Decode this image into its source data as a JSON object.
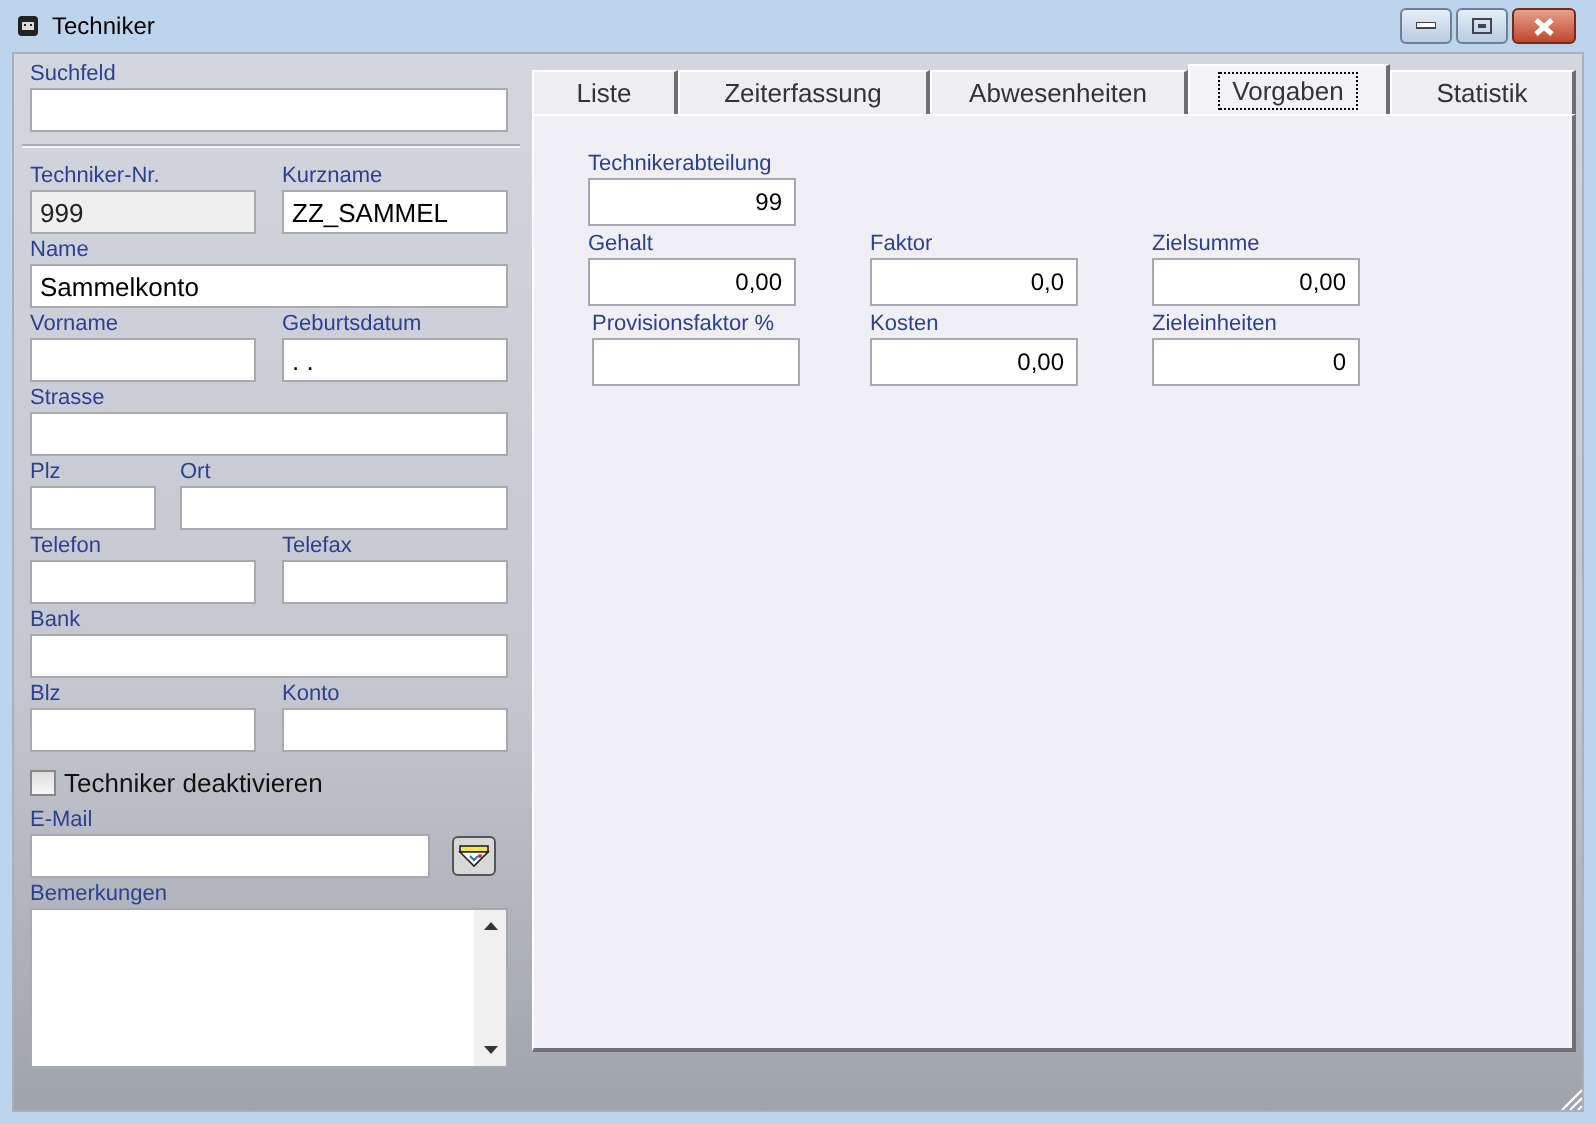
{
  "window": {
    "title": "Techniker"
  },
  "search": {
    "label": "Suchfeld"
  },
  "left_rows": [
    {
      "kind": "split",
      "fields": [
        {
          "label": "Techniker-Nr.",
          "value": "999",
          "disabled": true
        },
        {
          "label": "Kurzname",
          "value": "ZZ_SAMMEL",
          "disabled": false
        }
      ]
    },
    {
      "kind": "full",
      "fields": [
        {
          "label": "Name",
          "value": "Sammelkonto",
          "disabled": false
        }
      ]
    },
    {
      "kind": "split",
      "fields": [
        {
          "label": "Vorname",
          "disabled": false
        },
        {
          "label": "Geburtsdatum",
          "value": ". .",
          "disabled": false
        }
      ]
    },
    {
      "kind": "full",
      "fields": [
        {
          "label": "Strasse",
          "disabled": false
        }
      ]
    },
    {
      "kind": "narrow",
      "fields": [
        {
          "label": "Plz",
          "disabled": false
        },
        {
          "label": "Ort",
          "disabled": false
        }
      ]
    },
    {
      "kind": "split",
      "fields": [
        {
          "label": "Telefon",
          "disabled": false
        },
        {
          "label": "Telefax",
          "disabled": false
        }
      ]
    },
    {
      "kind": "full",
      "fields": [
        {
          "label": "Bank",
          "disabled": false
        }
      ]
    },
    {
      "kind": "split",
      "fields": [
        {
          "label": "Blz",
          "disabled": false
        },
        {
          "label": "Konto",
          "disabled": false
        }
      ]
    }
  ],
  "deactivate": {
    "label": "Techniker deaktivieren",
    "checked": false
  },
  "email": {
    "label": "E-Mail"
  },
  "notes": {
    "label": "Bemerkungen"
  },
  "tabs": [
    {
      "label": "Liste",
      "selected": false
    },
    {
      "label": "Zeiterfassung",
      "selected": false
    },
    {
      "label": "Abwesenheiten",
      "selected": false
    },
    {
      "label": "Vorgaben",
      "selected": true
    },
    {
      "label": "Statistik",
      "selected": false
    }
  ],
  "right_rows": [
    [
      {
        "label": "Technikerabteilung",
        "value": "99"
      }
    ],
    [
      {
        "label": "Gehalt",
        "value": "0,00"
      },
      {
        "label": "Faktor",
        "value": "0,0"
      },
      {
        "label": "Zielsumme",
        "value": "0,00"
      }
    ],
    [
      {
        "label": "Provisionsfaktor %"
      },
      {
        "label": "Kosten",
        "value": "0,00"
      },
      {
        "label": "Zieleinheiten",
        "value": "0"
      }
    ]
  ]
}
